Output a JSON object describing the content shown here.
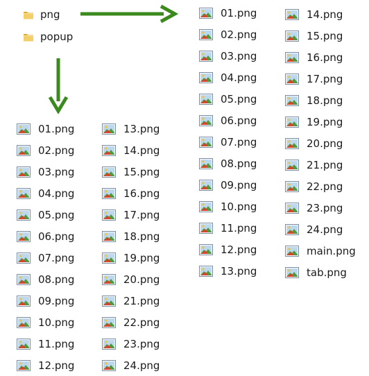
{
  "folders": [
    {
      "name": "png",
      "icon": "folder-icon"
    },
    {
      "name": "popup",
      "icon": "folder-icon"
    }
  ],
  "png_listing": {
    "columns": [
      [
        "01.png",
        "02.png",
        "03.png",
        "04.png",
        "05.png",
        "06.png",
        "07.png",
        "08.png",
        "09.png",
        "10.png",
        "11.png",
        "12.png",
        "13.png"
      ],
      [
        "14.png",
        "15.png",
        "16.png",
        "17.png",
        "18.png",
        "19.png",
        "20.png",
        "21.png",
        "22.png",
        "23.png",
        "24.png",
        "main.png",
        "tab.png"
      ]
    ]
  },
  "popup_listing": {
    "columns": [
      [
        "01.png",
        "02.png",
        "03.png",
        "04.png",
        "05.png",
        "06.png",
        "07.png",
        "08.png",
        "09.png",
        "10.png",
        "11.png",
        "12.png"
      ],
      [
        "13.png",
        "14.png",
        "15.png",
        "16.png",
        "17.png",
        "18.png",
        "19.png",
        "20.png",
        "21.png",
        "22.png",
        "23.png",
        "24.png"
      ]
    ]
  },
  "colors": {
    "arrow": "#3a8a1e",
    "folder": "#e8c15a",
    "text": "#1a1a1a"
  },
  "icons": {
    "file": "image-file-icon",
    "folder": "folder-icon",
    "arrow": "arrow-icon"
  }
}
